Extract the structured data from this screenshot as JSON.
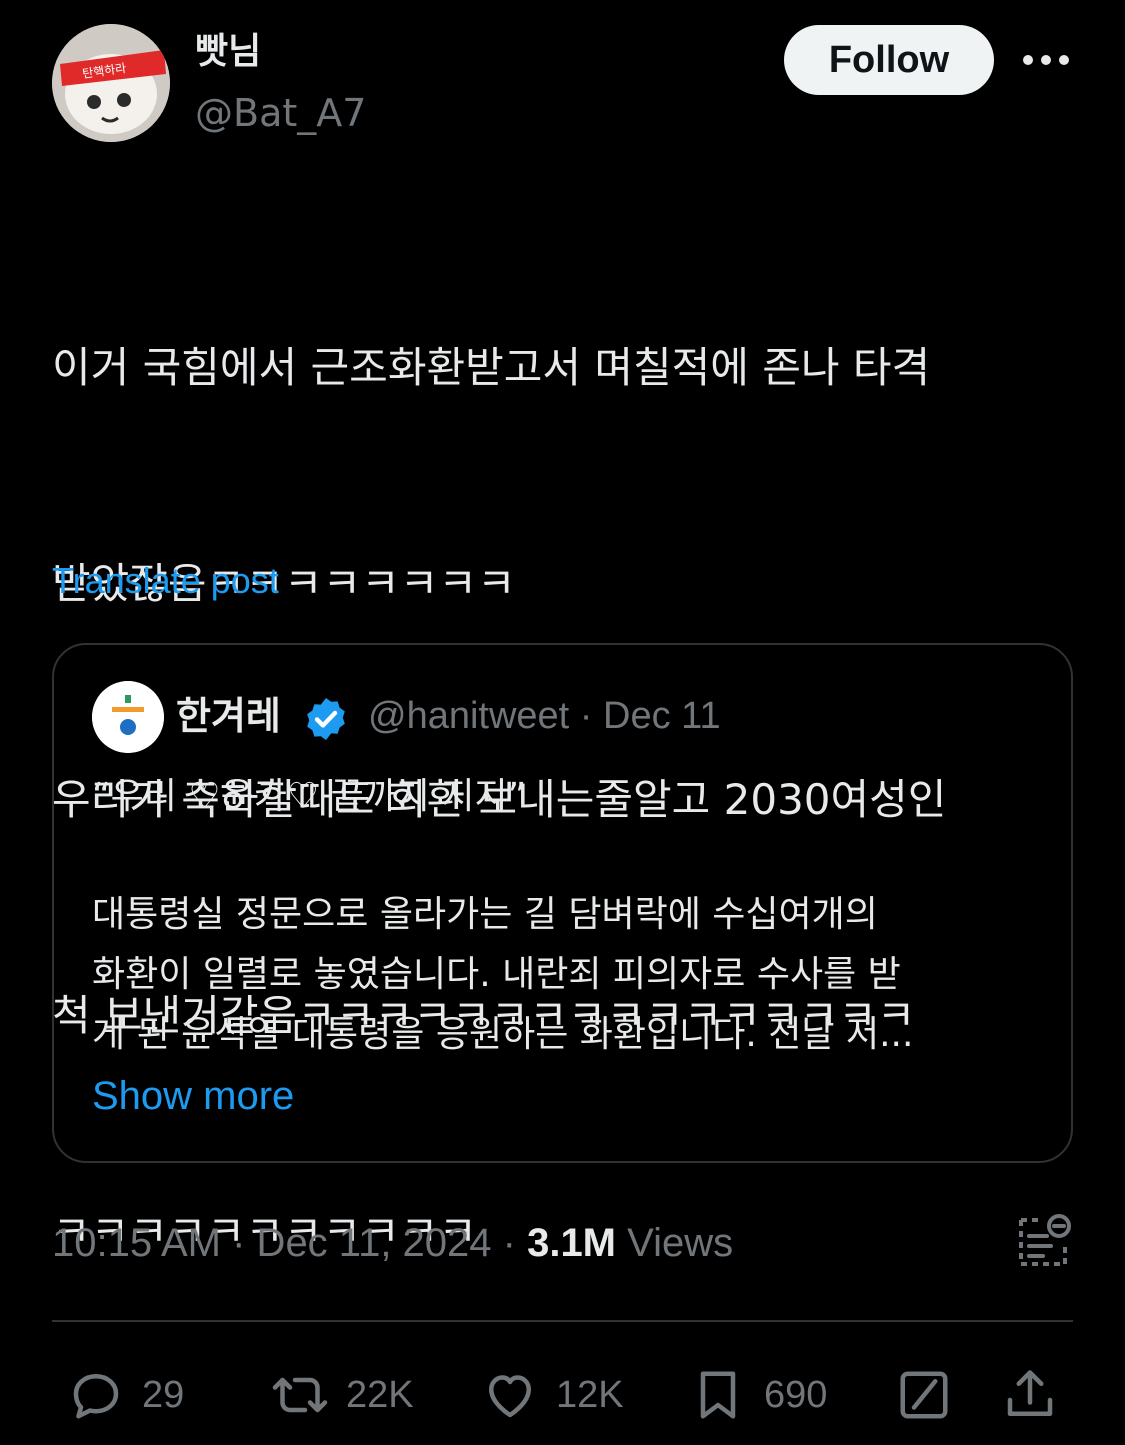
{
  "author": {
    "name": "빳님",
    "handle": "@Bat_A7",
    "headband_text": "탄핵하라"
  },
  "header": {
    "follow_label": "Follow",
    "more_icon": "more-horizontal-icon"
  },
  "post": {
    "lines": [
      "이거 국힘에서 근조화환받고서 며칠적에 존나 타격",
      "받았잖음ㅋㅋㅋㅋㅋㅋㅋㅋ",
      "우리가 축하할때도 회환 보내는줄알고 2030여성인",
      "척 보낸거같음ㅋㅋㅋㅋㅋㅋㅋㅋㅋㅋㅋㅋㅋㅋㅋㅋ",
      "ㅋㅋㅋㅋㅋㅋㅋㅋㅋㅋㅋ"
    ],
    "translate_label": "Translate post"
  },
  "quote": {
    "name": "한겨레",
    "handle_date": "@hanitweet · Dec 11",
    "headline": "“우리 ♡윤카♡ 끝까지 지지”",
    "body_lines": [
      "대통령실 정문으로 올라가는 길 담벼락에 수십여개의",
      "화환이 일렬로 놓였습니다. 내란죄 피의자로 수사를 받",
      "게 된 윤석열 대통령을 응원하는 화환입니다. 전날 저..."
    ],
    "show_more_label": "Show more",
    "verified_color": "#1d9bf0"
  },
  "meta": {
    "time_date": "10:15 AM · Dec 11, 2024 · ",
    "views_count": "3.1M",
    "views_label": " Views"
  },
  "actions": {
    "reply_count": "29",
    "retweet_count": "22K",
    "like_count": "12K",
    "bookmark_count": "690"
  },
  "colors": {
    "background": "#000000",
    "text": "#e7e9ea",
    "secondary": "#71767b",
    "accent": "#1d9bf0",
    "border": "#2f3336"
  }
}
